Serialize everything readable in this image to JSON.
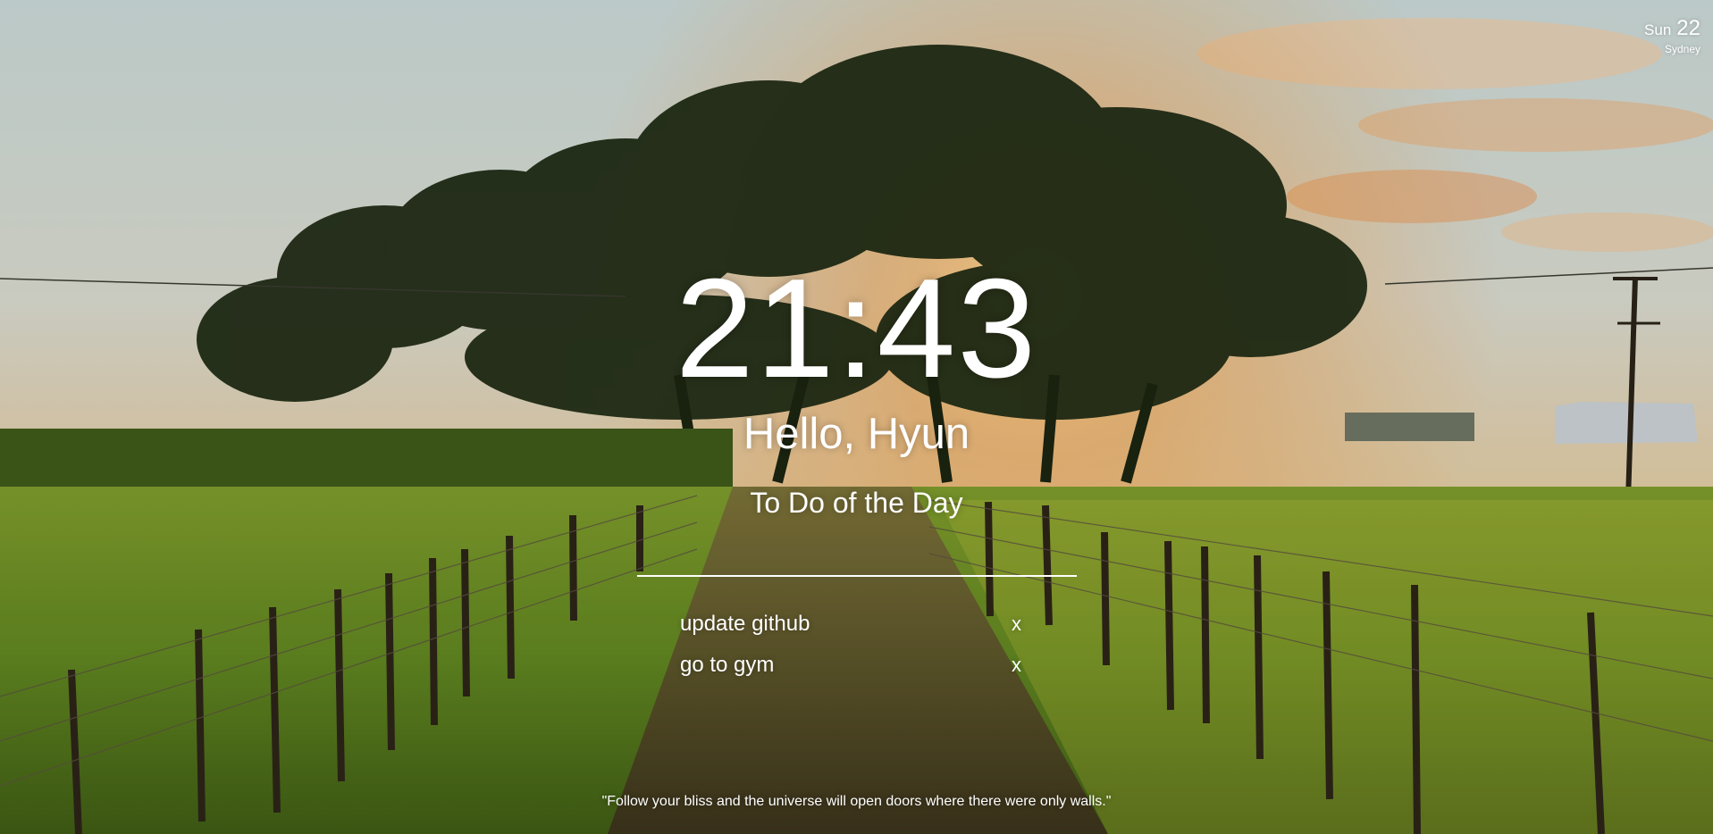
{
  "weather": {
    "day": "Sun",
    "date": "22",
    "city": "Sydney"
  },
  "clock": {
    "time": "21:43"
  },
  "greeting": {
    "text": "Hello, Hyun"
  },
  "todo": {
    "title": "To Do of the Day",
    "input_value": "",
    "items": [
      {
        "label": "update github",
        "delete_label": "x"
      },
      {
        "label": "go to gym",
        "delete_label": "x"
      }
    ]
  },
  "quote": {
    "text": "\"Follow your bliss and the universe will open doors where there were only walls.\""
  },
  "background": {
    "icon": "landscape-photo",
    "colors": {
      "sky": "#c8d6d4",
      "sun": "#f4a94a",
      "field": "#6b8a25"
    }
  }
}
